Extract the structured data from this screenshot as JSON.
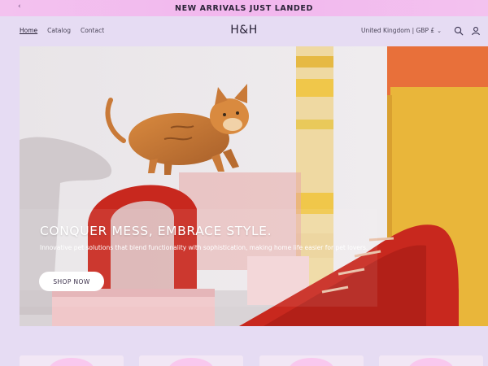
{
  "announcement": {
    "prev_arrow": "‹",
    "text": "NEW ARRIVALS JUST LANDED"
  },
  "header": {
    "nav": [
      {
        "label": "Home",
        "active": true
      },
      {
        "label": "Catalog",
        "active": false
      },
      {
        "label": "Contact",
        "active": false
      }
    ],
    "logo": "H&H",
    "locale": "United Kingdom | GBP £",
    "icons": [
      "search-icon",
      "account-icon",
      "chevron-down-icon"
    ]
  },
  "hero": {
    "title": "CONQUER MESS, EMBRACE STYLE.",
    "subtitle": "Innovative pet solutions that blend functionality with sophistication, making home life easier for pet lovers.",
    "cta": "SHOP NOW"
  },
  "cards": {
    "count": 4
  },
  "colors": {
    "page_bg": "#e6dcf3",
    "announcement_bg": "#f2b7ee",
    "accent_red": "#c8281e",
    "accent_yellow": "#e8b92a"
  }
}
